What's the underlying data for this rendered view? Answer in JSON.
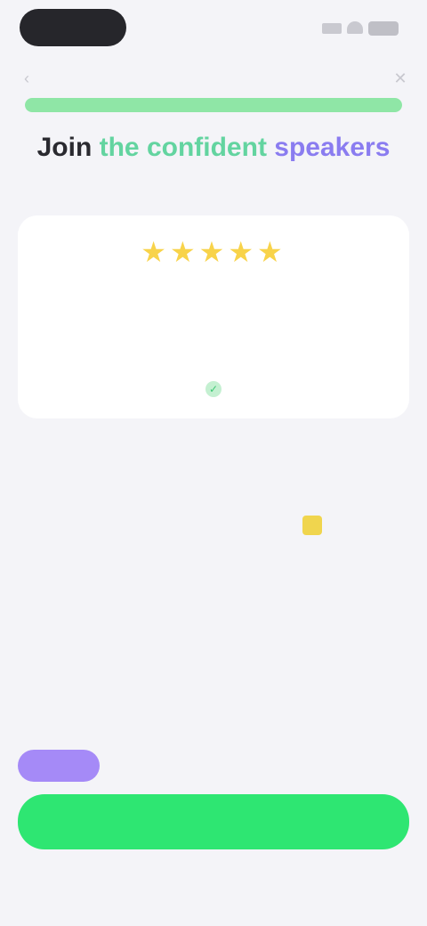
{
  "status_bar": {
    "icons": [
      "signal-icon",
      "wifi-icon",
      "battery-icon"
    ]
  },
  "navigation": {
    "back_icon": "chevron-left-icon",
    "close_icon": "close-icon"
  },
  "progress": {
    "fraction": 1.0,
    "colors": {
      "track": "#d2f5db",
      "fill": "#8fe6a6"
    }
  },
  "headline": {
    "part1": "Join",
    "part2": "the confident",
    "part3": "speakers",
    "colors": {
      "part2": "#63d4a0",
      "part3": "#8a7cf0"
    }
  },
  "subhead": "",
  "review": {
    "stars": "★★★★★",
    "text": "",
    "author": "",
    "verified_icon": "check-icon"
  },
  "comparison": {
    "title": "",
    "left_header": "",
    "right_header": "",
    "rows": [
      {
        "left": "",
        "right": "",
        "style": "big-num"
      },
      {
        "left": "",
        "right": "",
        "style": "small-val"
      },
      {
        "left": "",
        "right": "",
        "style": "small-val"
      }
    ]
  },
  "promo": {
    "badge": "",
    "text": ""
  },
  "cta": {
    "label": ""
  },
  "footnote": "",
  "colors": {
    "accent_green": "#2ee672",
    "accent_purple": "#a58af7",
    "star_yellow": "#f8d34a",
    "background": "#f4f4f8"
  }
}
